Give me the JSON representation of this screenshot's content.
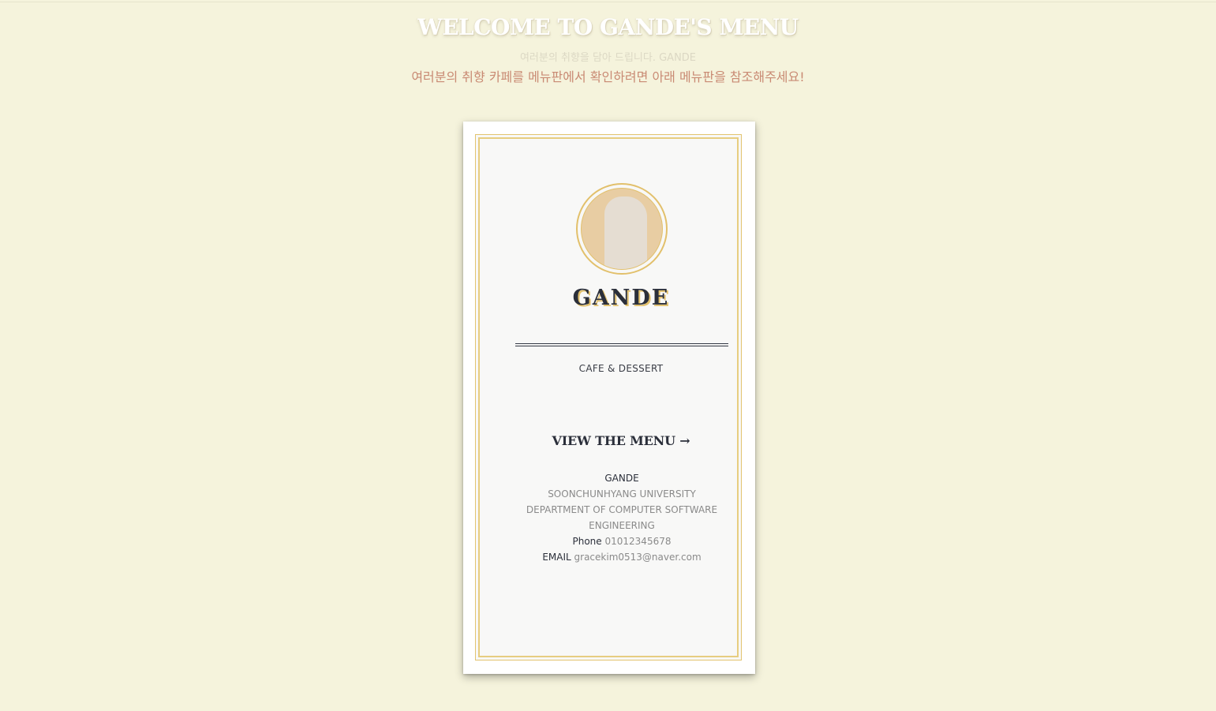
{
  "header": {
    "title": "WELCOME TO GANDE'S MENU",
    "subtitle_faint": "여러분의 취향을 담아 드립니다. GANDE",
    "subtitle_prompt": "여러분의 취향 카페를 메뉴판에서 확인하려면 아래 메뉴판을 참조해주세요!"
  },
  "card": {
    "logo_icon": "coffee-cup-logo",
    "brand": "GANDE",
    "tagline": "CAFE & DESSERT",
    "view_menu_label": "VIEW THE MENU",
    "view_menu_arrow": "→",
    "info": {
      "name": "GANDE",
      "university": "SOONCHUNHYANG UNIVERSITY",
      "department_line1": "DEPARTMENT OF COMPUTER SOFTWARE",
      "department_line2": "ENGINEERING",
      "phone_label": "Phone",
      "phone_value": "01012345678",
      "email_label": "EMAIL",
      "email_value": "gracekim0513@naver.com"
    }
  },
  "colors": {
    "background": "#f5f3dc",
    "accent_gold": "#e2c06b",
    "ink": "#2b2f3a",
    "rose_text": "#c98a73"
  }
}
